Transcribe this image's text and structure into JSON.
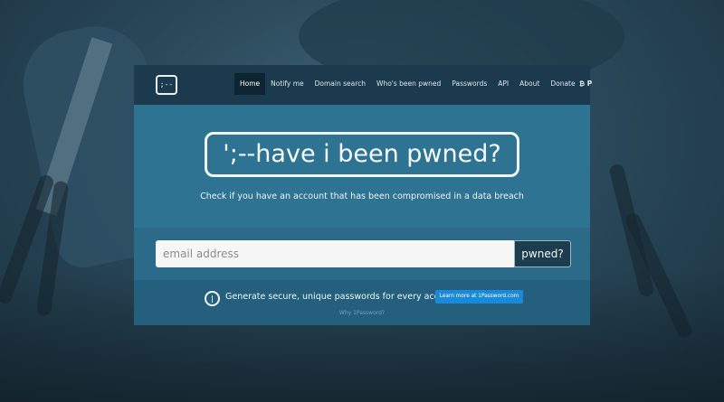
{
  "navbar": {
    "logo_text": ";--",
    "items": [
      {
        "label": "Home",
        "active": true
      },
      {
        "label": "Notify me"
      },
      {
        "label": "Domain search"
      },
      {
        "label": "Who's been pwned"
      },
      {
        "label": "Passwords"
      },
      {
        "label": "API"
      },
      {
        "label": "About"
      },
      {
        "label": "Donate"
      }
    ],
    "donate_icons": "₿ P"
  },
  "hero": {
    "title": "';--have i been pwned?",
    "tagline": "Check if you have an account that has been compromised in a data breach"
  },
  "search": {
    "placeholder": "email address",
    "button_label": "pwned?"
  },
  "promo": {
    "icon": "1password-icon",
    "text": "Generate secure, unique passwords for every account",
    "button_label": "Learn more at 1Password.com",
    "why_link": "Why 1Password?"
  },
  "colors": {
    "navbar": "#1c3a4d",
    "hero": "#2f7393",
    "accent_button": "#1a8ad8"
  }
}
